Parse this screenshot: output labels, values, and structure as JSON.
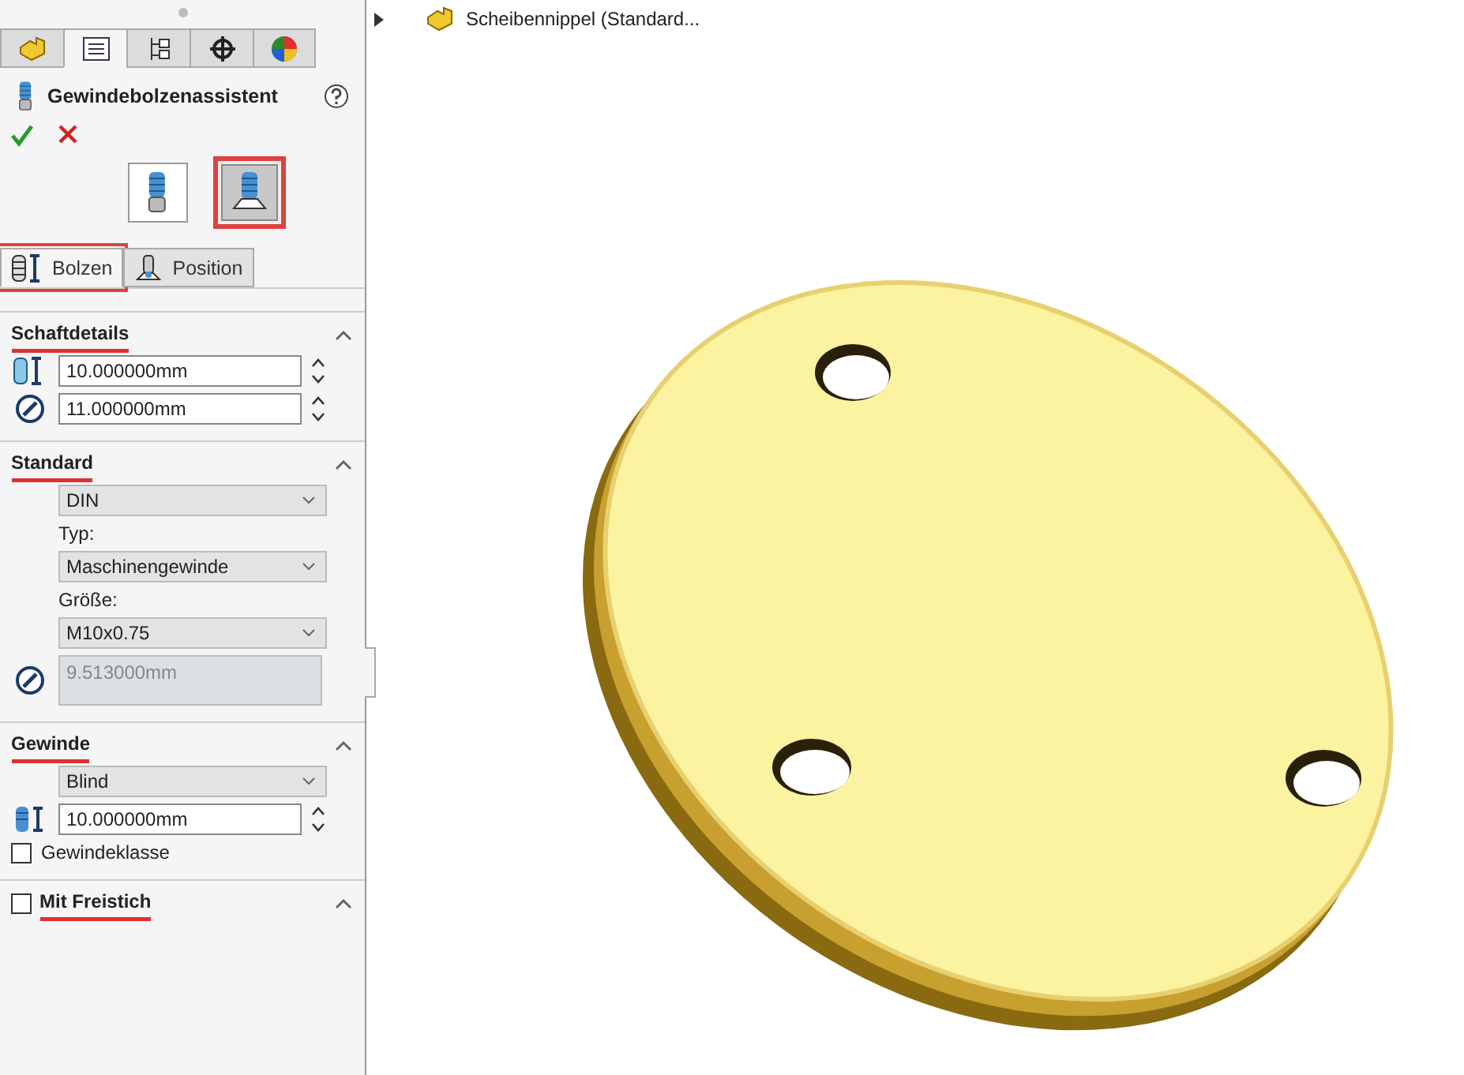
{
  "manager_tabs": [
    {
      "kind": "part",
      "selected": false
    },
    {
      "kind": "property",
      "selected": true
    },
    {
      "kind": "config",
      "selected": false
    },
    {
      "kind": "target",
      "selected": false
    },
    {
      "kind": "appearance",
      "selected": false
    }
  ],
  "title": "Gewindebolzenassistent",
  "type_buttons": [
    {
      "kind": "stud",
      "selected": false,
      "highlighted": false
    },
    {
      "kind": "base-stud",
      "selected": true,
      "highlighted": true
    }
  ],
  "subtabs": [
    {
      "label": "Bolzen",
      "kind": "stud",
      "selected": true,
      "highlighted": true
    },
    {
      "label": "Position",
      "kind": "position",
      "selected": false,
      "highlighted": false
    }
  ],
  "sections": [
    {
      "title": "Schaftdetails",
      "highlighted": true,
      "expanded": true,
      "items": [
        {
          "kind": "length",
          "value": "10.000000mm"
        },
        {
          "kind": "diameter",
          "value": "11.000000mm"
        }
      ]
    },
    {
      "title": "Standard",
      "highlighted": true,
      "expanded": true,
      "items": [
        {
          "kind": "dropdown",
          "value": "DIN"
        },
        {
          "kind": "label",
          "text": "Typ:"
        },
        {
          "kind": "dropdown",
          "value": "Maschinengewinde"
        },
        {
          "kind": "label",
          "text": "Größe:"
        },
        {
          "kind": "dropdown",
          "value": "M10x0.75"
        },
        {
          "kind": "readonly",
          "value": "9.513000mm"
        }
      ]
    },
    {
      "title": "Gewinde",
      "highlighted": true,
      "expanded": true,
      "items": [
        {
          "kind": "dropdown",
          "value": "Blind"
        },
        {
          "kind": "depth",
          "value": "10.000000mm"
        },
        {
          "kind": "checkbox",
          "text": "Gewindeklasse",
          "checked": false
        }
      ]
    },
    {
      "title": "Mit Freistich",
      "highlighted": true,
      "expanded": true,
      "checked": false
    }
  ],
  "tree": {
    "label": "Scheibennippel (Standard...",
    "expanded": false
  }
}
